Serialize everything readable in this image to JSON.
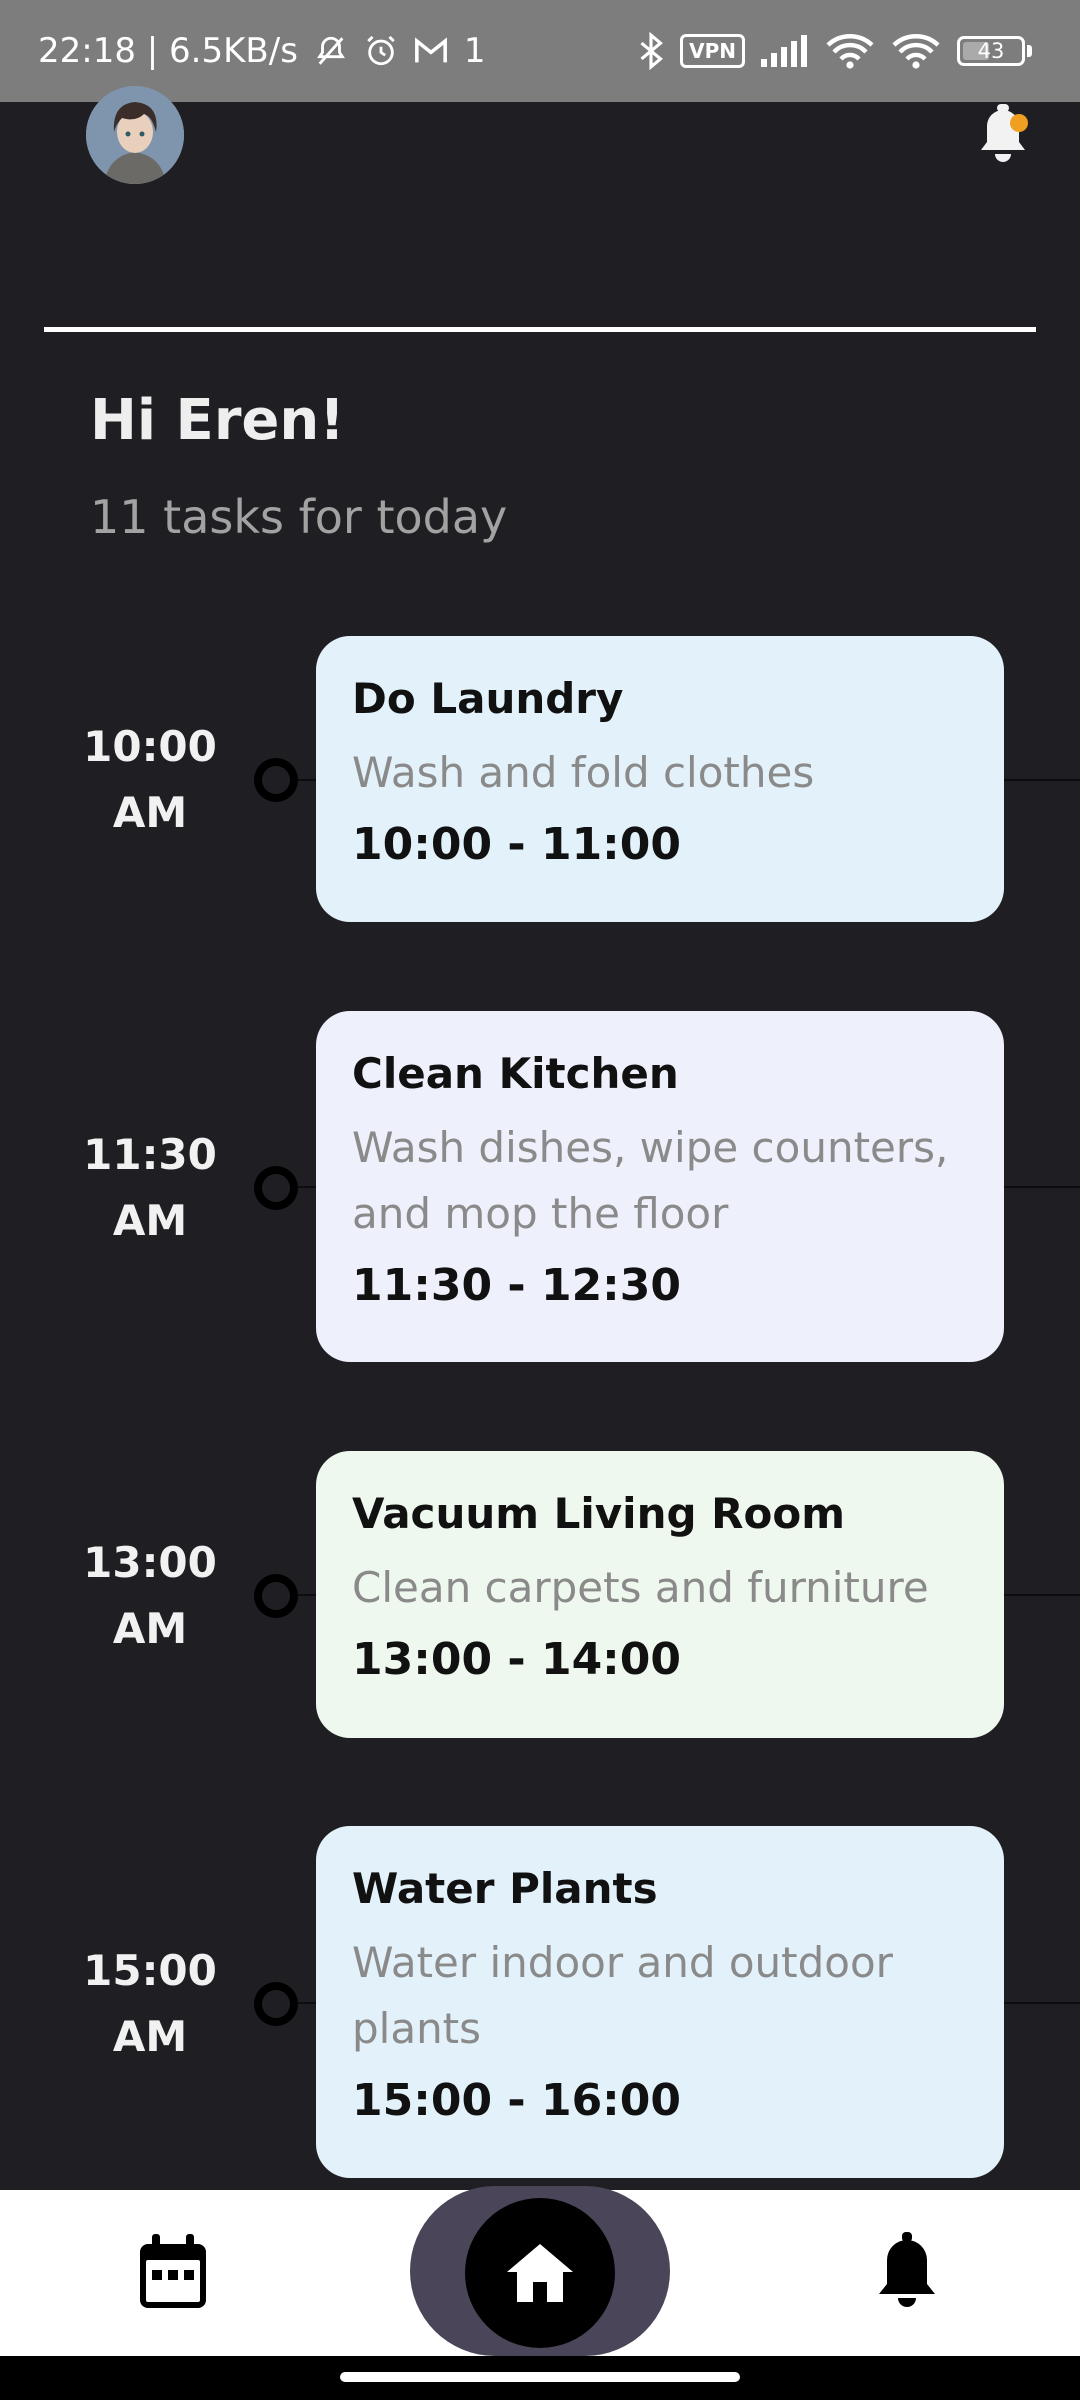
{
  "status_bar": {
    "time_speed": "22:18 | 6.5KB/s",
    "extra": "1",
    "vpn": "VPN",
    "battery": "43"
  },
  "header": {
    "greeting": "Hi Eren!",
    "subtitle": "11 tasks for today"
  },
  "tasks": [
    {
      "time_line1": "10:00",
      "time_line2": "AM",
      "title": "Do Laundry",
      "description": "Wash and fold clothes",
      "range": "10:00 - 11:00",
      "color": "#e3f2fa"
    },
    {
      "time_line1": "11:30",
      "time_line2": "AM",
      "title": "Clean Kitchen",
      "description": "Wash dishes, wipe counters, and mop the floor",
      "range": "11:30 - 12:30",
      "color": "#eef0fc"
    },
    {
      "time_line1": "13:00",
      "time_line2": "AM",
      "title": "Vacuum Living Room",
      "description": "Clean carpets and furniture",
      "range": "13:00 - 14:00",
      "color": "#eef8ee"
    },
    {
      "time_line1": "15:00",
      "time_line2": "AM",
      "title": "Water Plants",
      "description": "Water indoor and outdoor plants",
      "range": "15:00 - 16:00",
      "color": "#e3f2fa"
    }
  ],
  "nav": {
    "items": [
      {
        "icon": "calendar-icon"
      },
      {
        "icon": "home-icon",
        "active": true
      },
      {
        "icon": "bell-icon"
      }
    ]
  },
  "colors": {
    "background": "#1f1f23",
    "accent_dot": "#f0a020",
    "home_halo": "#4a4558"
  }
}
